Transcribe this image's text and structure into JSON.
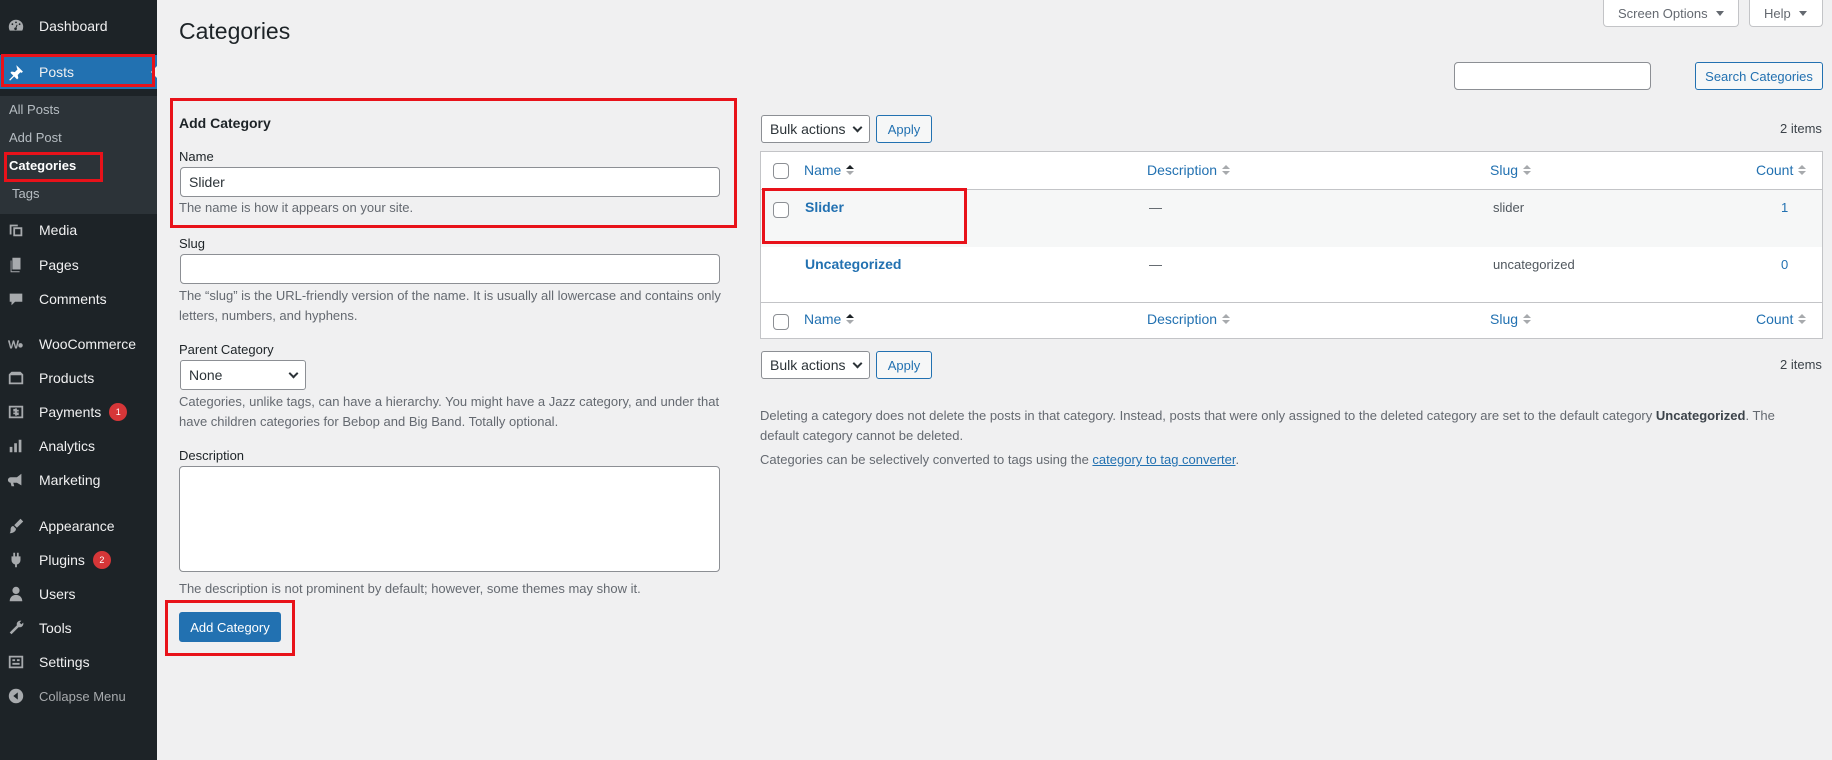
{
  "sidebar": {
    "items": [
      {
        "label": "Dashboard",
        "icon": "dashboard-icon"
      },
      {
        "label": "Posts",
        "icon": "pushpin-icon"
      },
      {
        "label": "Media",
        "icon": "media-icon"
      },
      {
        "label": "Pages",
        "icon": "pages-icon"
      },
      {
        "label": "Comments",
        "icon": "comments-icon"
      },
      {
        "label": "WooCommerce",
        "icon": "woocommerce-icon"
      },
      {
        "label": "Products",
        "icon": "products-icon"
      },
      {
        "label": "Payments",
        "icon": "payments-icon",
        "badge": "1"
      },
      {
        "label": "Analytics",
        "icon": "analytics-icon"
      },
      {
        "label": "Marketing",
        "icon": "megaphone-icon"
      },
      {
        "label": "Appearance",
        "icon": "paintbrush-icon"
      },
      {
        "label": "Plugins",
        "icon": "plugin-icon",
        "badge": "2"
      },
      {
        "label": "Users",
        "icon": "users-icon"
      },
      {
        "label": "Tools",
        "icon": "wrench-icon"
      },
      {
        "label": "Settings",
        "icon": "settings-icon"
      },
      {
        "label": "Collapse Menu",
        "icon": "collapse-icon"
      }
    ],
    "submenu": [
      "All Posts",
      "Add Post",
      "Categories",
      "Tags"
    ]
  },
  "header": {
    "title": "Categories",
    "screen_options": "Screen Options",
    "help": "Help"
  },
  "search": {
    "value": "",
    "button": "Search Categories"
  },
  "form": {
    "heading": "Add Category",
    "name_label": "Name",
    "name_value": "Slider",
    "name_help": "The name is how it appears on your site.",
    "slug_label": "Slug",
    "slug_value": "",
    "slug_help_1": "The “slug” is the URL-friendly version of the name. It is usually all lowercase and contains only",
    "slug_help_2": "letters, numbers, and hyphens.",
    "parent_label": "Parent Category",
    "parent_value": "None",
    "parent_help_1": "Categories, unlike tags, can have a hierarchy. You might have a Jazz category, and under that",
    "parent_help_2": "have children categories for Bebop and Big Band. Totally optional.",
    "description_label": "Description",
    "description_value": "",
    "description_help": "The description is not prominent by default; however, some themes may show it.",
    "submit": "Add Category"
  },
  "table": {
    "bulk_actions": "Bulk actions",
    "apply": "Apply",
    "items_count": "2 items",
    "columns": [
      "Name",
      "Description",
      "Slug",
      "Count"
    ],
    "rows": [
      {
        "name": "Slider",
        "description": "—",
        "slug": "slider",
        "count": "1"
      },
      {
        "name": "Uncategorized",
        "description": "—",
        "slug": "uncategorized",
        "count": "0"
      }
    ]
  },
  "notes": {
    "delete_1": "Deleting a category does not delete the posts in that category. Instead, posts that were only assigned to the deleted category are set to the default category ",
    "delete_bold": "Uncategorized",
    "delete_2": ". The",
    "delete_3": "default category cannot be deleted.",
    "convert_1": "Categories can be selectively converted to tags using the ",
    "convert_link": "category to tag converter",
    "convert_2": "."
  }
}
